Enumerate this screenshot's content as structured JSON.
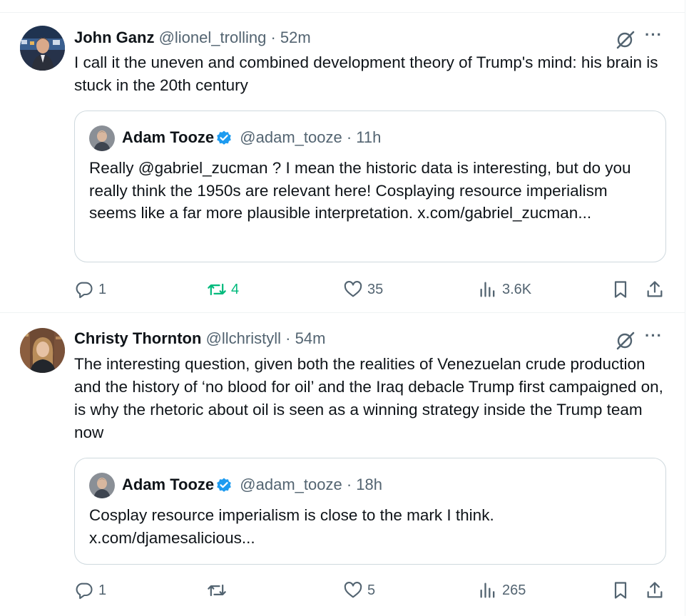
{
  "tweets": [
    {
      "author": "John Ganz",
      "handle": "@lionel_trolling",
      "separator": "·",
      "time": "52m",
      "text": "I call it the uneven and combined development theory of Trump's mind: his brain is stuck in the 20th century",
      "quote": {
        "author": "Adam Tooze",
        "handle": "@adam_tooze",
        "separator": "·",
        "time": "11h",
        "text": "Really @gabriel_zucman ? I mean the historic data is interesting, but do you really think the 1950s are relevant here! Cosplaying resource imperialism seems like a far more plausible interpretation. x.com/gabriel_zucman..."
      },
      "replies": "1",
      "reposts": "4",
      "likes": "35",
      "views": "3.6K"
    },
    {
      "author": "Christy Thornton",
      "handle": "@llchristyll",
      "separator": "·",
      "time": "54m",
      "text": "The interesting question, given both the realities of Venezuelan crude production and the history of ‘no blood for oil’ and the Iraq debacle Trump first campaigned on, is why the rhetoric about oil is seen as a winning strategy inside the Trump team now",
      "quote": {
        "author": "Adam Tooze",
        "handle": "@adam_tooze",
        "separator": "·",
        "time": "18h",
        "text": "Cosplay resource imperialism is close to the mark I think. x.com/djamesalicious..."
      },
      "replies": "1",
      "reposts": "",
      "likes": "5",
      "views": "265"
    }
  ],
  "more_glyph": "···",
  "icons": [
    "grok-icon",
    "more-icon",
    "reply-icon",
    "repost-icon",
    "like-icon",
    "views-icon",
    "bookmark-icon",
    "share-icon",
    "verified-icon"
  ],
  "colors": {
    "text": "#0f1419",
    "muted": "#536471",
    "repost_active": "#00ba7c",
    "verified": "#1d9bf0",
    "border": "#cfd9de"
  }
}
